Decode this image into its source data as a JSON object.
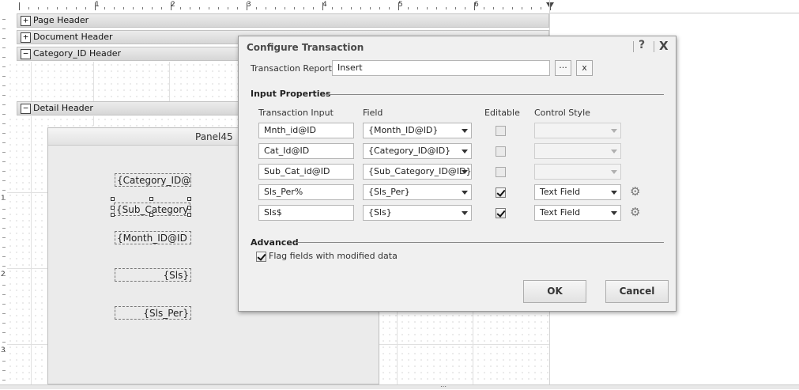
{
  "ruler": {
    "marks": [
      "1",
      "2",
      "3",
      "4",
      "5",
      "6"
    ],
    "vmarks": [
      "1",
      "2",
      "3"
    ]
  },
  "bands": {
    "page_header": {
      "toggle": "+",
      "label": "Page Header"
    },
    "document_header": {
      "toggle": "+",
      "label": "Document Header"
    },
    "category_header": {
      "toggle": "−",
      "label": "Category_ID Header"
    },
    "detail_header": {
      "toggle": "−",
      "label": "Detail Header"
    }
  },
  "panel": {
    "title": "Panel45",
    "fields": {
      "category": "{Category_ID@",
      "sub_category": "{Sub_Category",
      "month": "{Month_ID@ID",
      "sls": "{Sls}",
      "sls_per": "{Sls_Per}"
    }
  },
  "bottom": {
    "grip": "⋯"
  },
  "dialog": {
    "title": "Configure Transaction",
    "help": "?",
    "close": "X",
    "transaction_report_label": "Transaction Report:",
    "transaction_report_value": "Insert",
    "browse_label": "···",
    "clear_label": "x",
    "input_properties_label": "Input Properties",
    "columns": {
      "input": "Transaction Input",
      "field": "Field",
      "editable": "Editable",
      "style": "Control Style"
    },
    "rows": [
      {
        "input": "Mnth_id@ID",
        "field": "{Month_ID@ID}",
        "editable": false,
        "style": ""
      },
      {
        "input": "Cat_Id@ID",
        "field": "{Category_ID@ID}",
        "editable": false,
        "style": ""
      },
      {
        "input": "Sub_Cat_id@ID",
        "field": "{Sub_Category_ID@ID}",
        "editable": false,
        "style": ""
      },
      {
        "input": "Sls_Per%",
        "field": "{Sls_Per}",
        "editable": true,
        "style": "Text Field"
      },
      {
        "input": "Sls$",
        "field": "{Sls}",
        "editable": true,
        "style": "Text Field"
      }
    ],
    "advanced_label": "Advanced",
    "flag_label": "Flag fields with modified data",
    "flag_checked": true,
    "ok_label": "OK",
    "cancel_label": "Cancel"
  }
}
